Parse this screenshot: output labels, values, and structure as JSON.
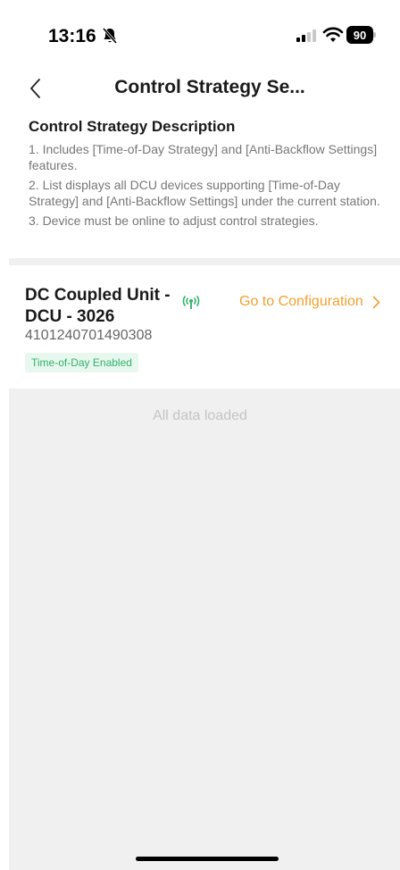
{
  "status_bar": {
    "time": "13:16",
    "battery_level": "90",
    "icons": [
      "bell-slash-icon",
      "signal-icon",
      "wifi-icon",
      "battery-icon"
    ]
  },
  "nav": {
    "title": "Control Strategy Se...",
    "back_icon": "chevron-left-icon"
  },
  "description": {
    "title": "Control Strategy Description",
    "items": [
      "1. Includes [Time-of-Day Strategy] and [Anti-Backflow Settings] features.",
      "2. List displays all DCU devices supporting [Time-of-Day Strategy] and [Anti-Backflow Settings] under the current station.",
      "3. Device must be online to adjust control strategies."
    ]
  },
  "devices": [
    {
      "name": "DC Coupled Unit - DCU - 3026",
      "id": "4101240701490308",
      "status_icon": "online-signal-icon",
      "action_label": "Go to Configuration",
      "badge": "Time-of-Day Enabled"
    }
  ],
  "list_footer": "All data loaded",
  "colors": {
    "accent": "#f0a030",
    "online": "#2fb36a",
    "badge_bg": "#e9f8ef",
    "page_gray": "#f0f0f0"
  }
}
